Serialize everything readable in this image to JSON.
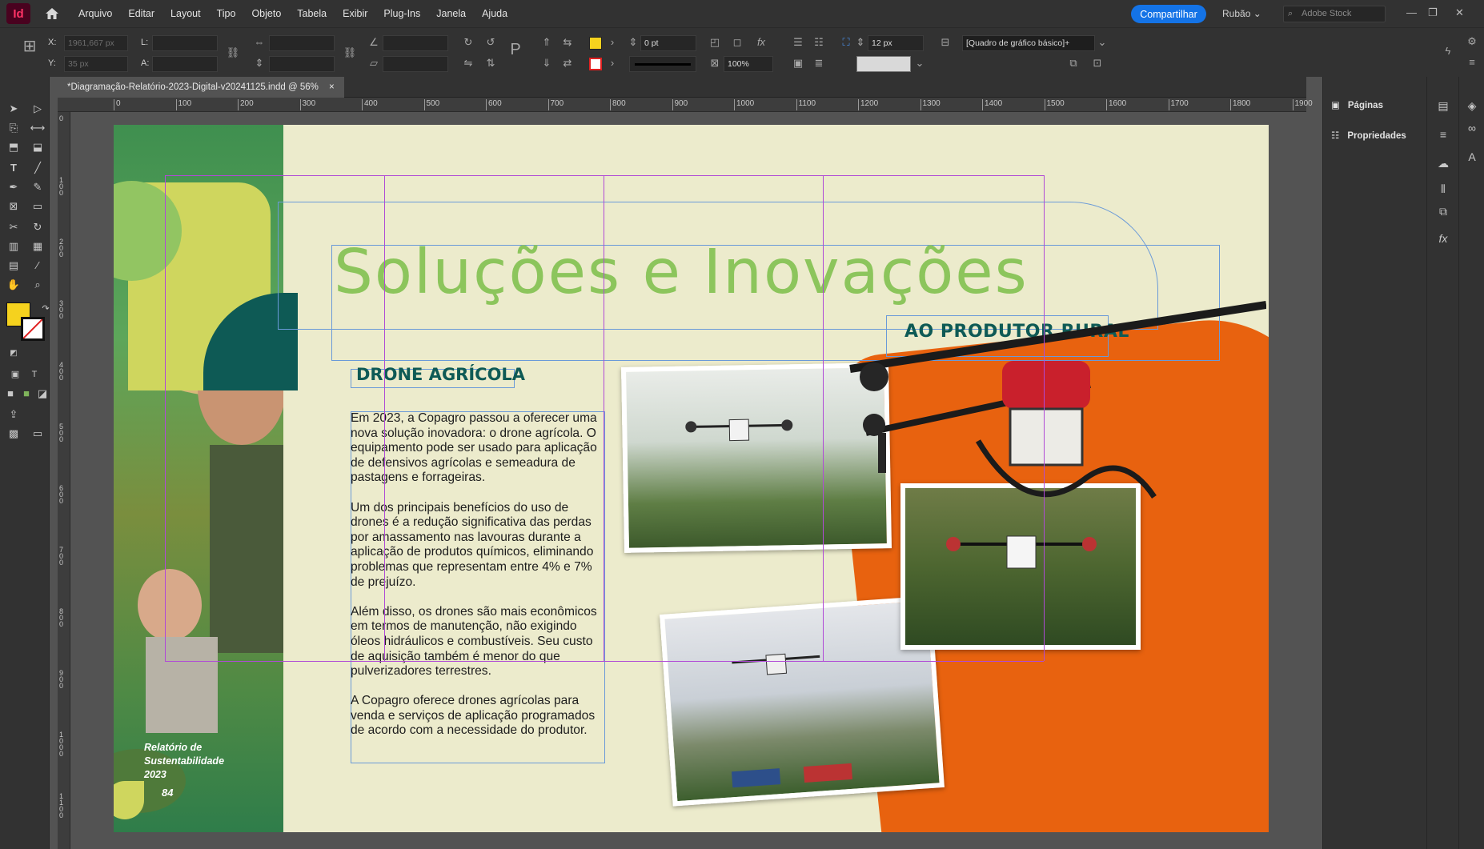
{
  "app": {
    "logo": "Id",
    "share_label": "Compartilhar",
    "user": "Rubão",
    "stock_placeholder": "Adobe Stock"
  },
  "menu": [
    "Arquivo",
    "Editar",
    "Layout",
    "Tipo",
    "Objeto",
    "Tabela",
    "Exibir",
    "Plug-Ins",
    "Janela",
    "Ajuda"
  ],
  "control": {
    "x_label": "X:",
    "y_label": "Y:",
    "w_label": "L:",
    "h_label": "A:",
    "x_value": "1961,667 px",
    "y_value": "35 px",
    "stroke_weight": "0 pt",
    "opacity": "100%",
    "corner_size": "12 px",
    "object_style": "[Quadro de gráfico básico]+",
    "fill_color": "#f5d21e"
  },
  "document": {
    "tab_title": "*Diagramação-Relatório-2023-Digital-v20241125.indd @ 56%",
    "close": "×"
  },
  "ruler": {
    "h_ticks": [
      "0",
      "100",
      "200",
      "300",
      "400",
      "500",
      "600",
      "700",
      "800",
      "900",
      "1000",
      "1100",
      "1200",
      "1300",
      "1400",
      "1500",
      "1600",
      "1700",
      "1800",
      "1900"
    ],
    "v_ticks": [
      "0",
      "1 0 0",
      "2 0 0",
      "3 0 0",
      "4 0 0",
      "5 0 0",
      "6 0 0",
      "7 0 0",
      "8 0 0",
      "9 0 0",
      "1 0 0 0",
      "1 1 0 0"
    ]
  },
  "panels": {
    "pages": "Páginas",
    "properties": "Propriedades"
  },
  "page_content": {
    "title": "Soluções e Inovações",
    "subtitle": "AO PRODUTOR RURAL",
    "section_heading": "DRONE AGRÍCOLA",
    "paragraphs": [
      "Em 2023, a Copagro passou a oferecer uma nova solução inovadora: o drone agrícola. O equipamento pode ser usado para aplicação de defensivos agrícolas e semeadura de pastagens e forrageiras.",
      "Um dos principais benefícios do uso de drones é a redução significativa das perdas por amassamento nas lavouras durante a aplicação de produtos químicos, eliminando problemas que representam entre 4% e 7% de prejuízo.",
      "Além disso, os drones são mais econômicos em termos de manutenção, não exigindo óleos hidráulicos e combustíveis. Seu custo de aquisição também é menor do que pulverizadores terrestres.",
      "A Copagro oferece drones agrícolas para venda e serviços de aplicação programados de acordo com a necessidade do produtor."
    ],
    "cover_label": [
      "Relatório de",
      "Sustentabilidade",
      "2023"
    ],
    "page_number": "84"
  },
  "colors": {
    "title_green": "#8cc55c",
    "dark_teal": "#0e5a55",
    "orange": "#e8620f",
    "lime": "#cfd65e",
    "page_bg": "#ecebcc",
    "accent_blue": "#1473e6"
  }
}
